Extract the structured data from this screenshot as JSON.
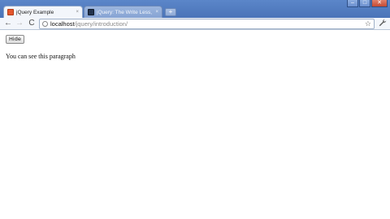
{
  "window": {
    "controls": {
      "minimize": "–",
      "maximize": "□",
      "close": "✕"
    }
  },
  "tabs": [
    {
      "label": "jQuery Example",
      "favicon": "html5-icon",
      "active": true,
      "close": "×"
    },
    {
      "label": "jQuery: The Write Less, D...",
      "favicon": "jquery-icon",
      "active": false,
      "close": "×"
    }
  ],
  "new_tab": "+",
  "toolbar": {
    "back": "←",
    "forward": "→",
    "reload": "C",
    "url_host": "localhost",
    "url_path": "/jquery/introduction/",
    "star": "☆",
    "wrench": "🔧"
  },
  "page": {
    "hide_button": "Hide",
    "paragraph": "You can see this paragraph"
  },
  "colors": {
    "titlebar": "#4a74b8",
    "toolbar": "#f3f6fb",
    "favicon_html": "#e4572e",
    "url_path": "#8a8a8a"
  }
}
